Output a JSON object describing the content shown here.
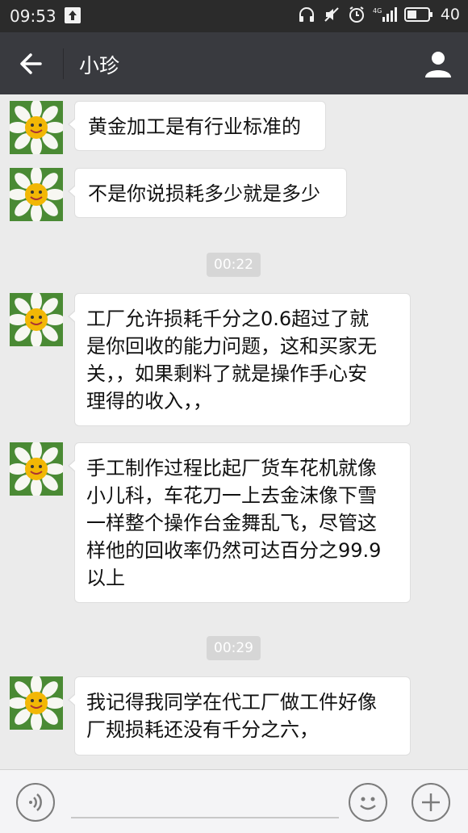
{
  "status_bar": {
    "time": "09:53",
    "battery": "40",
    "network": "4G"
  },
  "header": {
    "title": "小珍"
  },
  "messages": [
    {
      "sender": "contact",
      "text": "黄金加工是有行业标准的"
    },
    {
      "sender": "contact",
      "text": "不是你说损耗多少就是多少"
    },
    {
      "type": "timestamp",
      "text": "00:22"
    },
    {
      "sender": "contact",
      "lines": [
        "工厂允许损耗千分之0.6超过了就",
        "是你回收的能力问题，这和买家无",
        "关，，如果剩料了就是操作手心安",
        "理得的收入，，"
      ]
    },
    {
      "sender": "contact",
      "lines": [
        "手工制作过程比起厂货车花机就像",
        "小儿科，车花刀一上去金沫像下雪",
        "一样整个操作台金舞乱飞，尽管这",
        "样他的回收率仍然可达百分之99.9",
        "以上"
      ]
    },
    {
      "type": "timestamp",
      "text": "00:29"
    },
    {
      "sender": "contact",
      "lines": [
        "我记得我同学在代工厂做工件好像",
        "厂规损耗还没有千分之六，"
      ]
    }
  ],
  "colors": {
    "status_bar_bg": "#2b2b2b",
    "title_bar_bg": "#393a3f",
    "chat_bg": "#ebebeb",
    "bubble_bg": "#ffffff"
  }
}
